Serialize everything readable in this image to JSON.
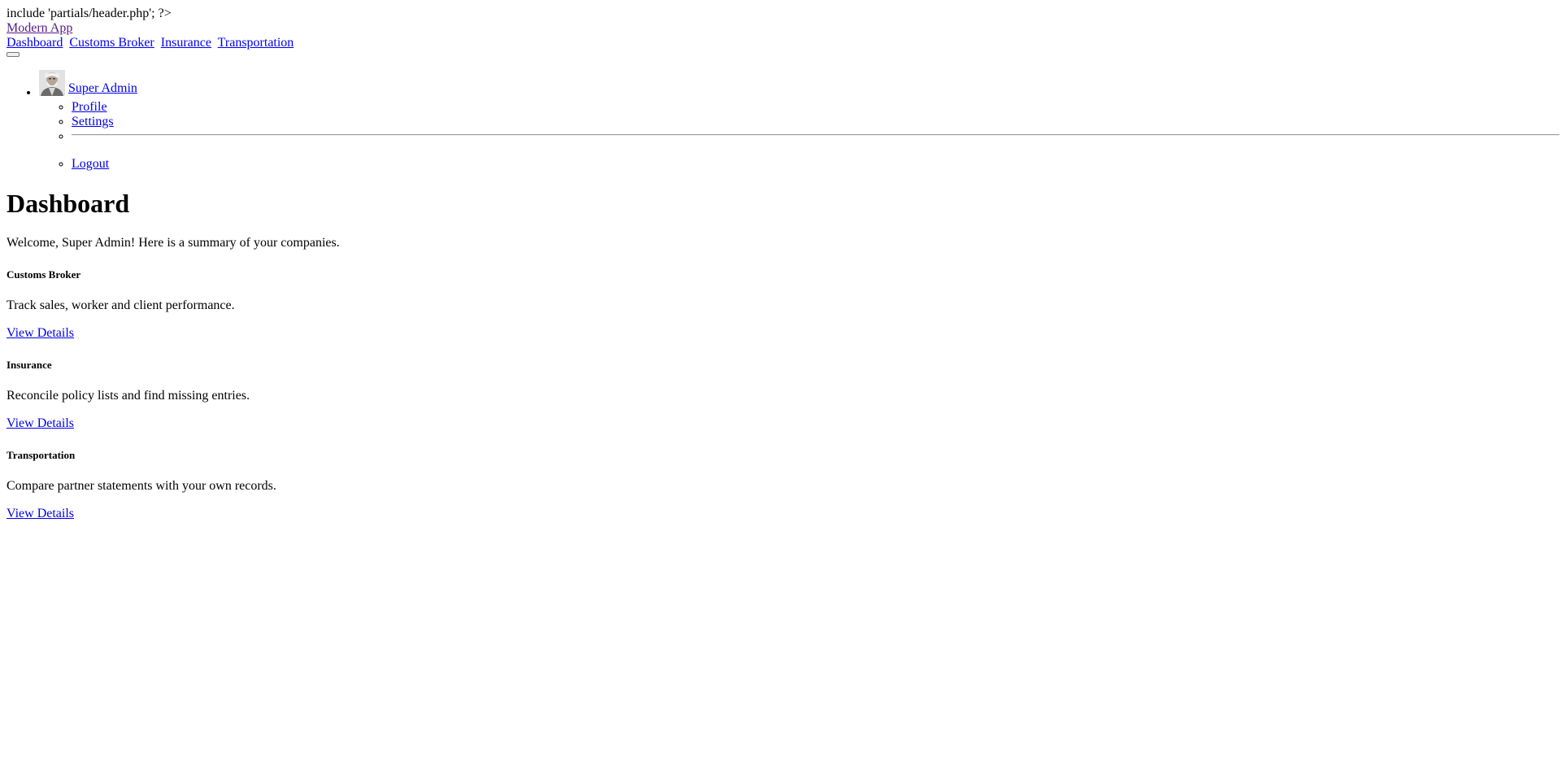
{
  "raw_include_text": "include 'partials/header.php'; ?>",
  "brand": "Modern App",
  "nav": {
    "items": [
      {
        "label": "Dashboard"
      },
      {
        "label": "Customs Broker"
      },
      {
        "label": "Insurance"
      },
      {
        "label": "Transportation"
      }
    ]
  },
  "user_menu": {
    "name": " Super Admin",
    "items": {
      "profile": "Profile",
      "settings": "Settings",
      "logout": "Logout"
    }
  },
  "page": {
    "title": "Dashboard",
    "welcome": "Welcome, Super Admin! Here is a summary of your companies."
  },
  "cards": [
    {
      "title": "Customs Broker",
      "description": "Track sales, worker and client performance.",
      "link": "View Details"
    },
    {
      "title": "Insurance",
      "description": "Reconcile policy lists and find missing entries.",
      "link": "View Details"
    },
    {
      "title": "Transportation",
      "description": "Compare partner statements with your own records.",
      "link": "View Details"
    }
  ],
  "colors": {
    "link": "#0000ee",
    "visited_link": "#551a8b",
    "text": "#000000",
    "background": "#ffffff"
  }
}
